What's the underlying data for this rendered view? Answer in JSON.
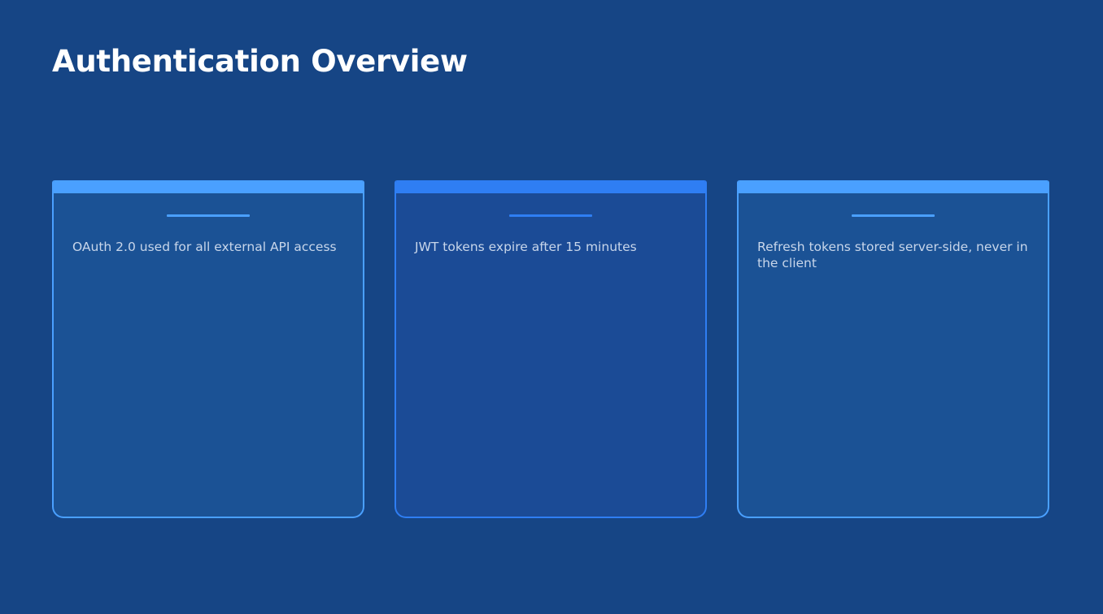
{
  "slide": {
    "title": "Authentication Overview"
  },
  "cards": [
    {
      "text": "OAuth 2.0 used for all external API access"
    },
    {
      "text": "JWT tokens expire after 15 minutes"
    },
    {
      "text": "Refresh tokens stored server-side, never in the client"
    }
  ],
  "colors": {
    "background": "#164585",
    "card_fill": "#1b5295",
    "card_accent": "#4aa0ff",
    "card_accent_alt": "#2f7ef3",
    "title_text": "#ffffff",
    "body_text": "#c8d6ea"
  }
}
